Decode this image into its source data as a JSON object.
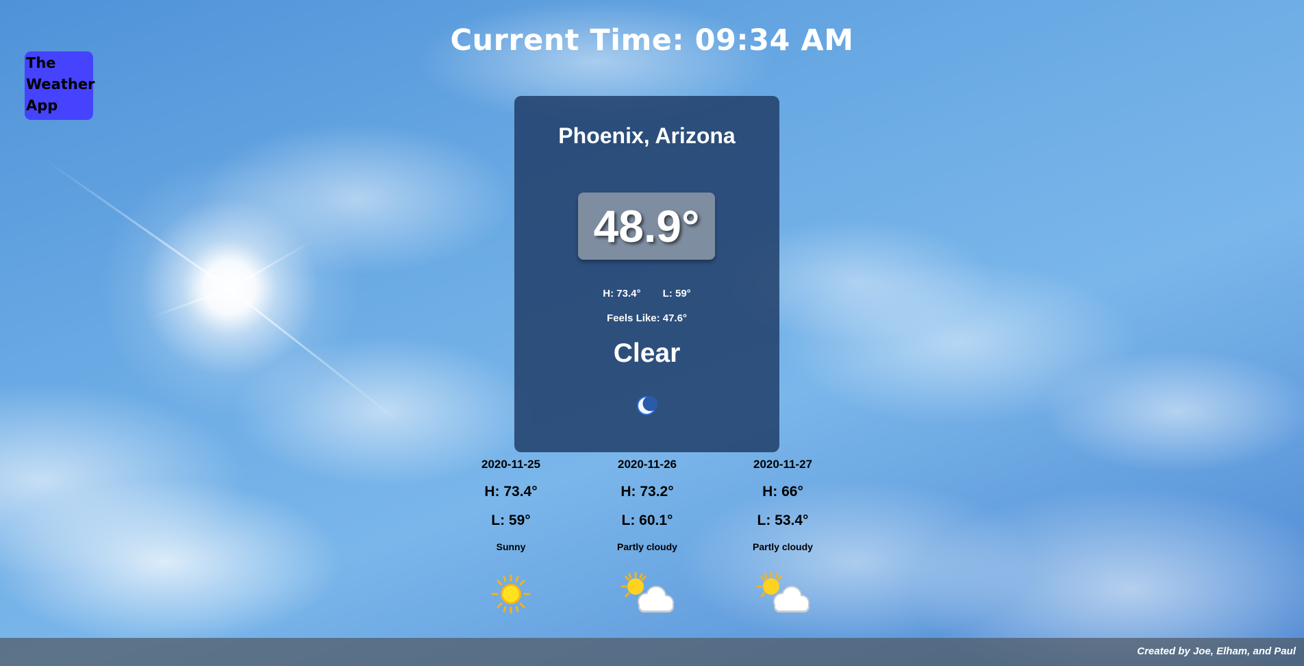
{
  "app": {
    "logo_text": "The\nWeather\nApp"
  },
  "clock": {
    "label": "Current Time: 09:34 AM"
  },
  "current": {
    "city": "Phoenix, Arizona",
    "temperature": "48.9°",
    "high": "H: 73.4°",
    "low": "L: 59°",
    "feels_like": "Feels Like: 47.6°",
    "condition": "Clear",
    "icon": "moon-icon"
  },
  "forecast": [
    {
      "date": "2020-11-25",
      "high": "H: 73.4°",
      "low": "L: 59°",
      "description": "Sunny",
      "icon": "sun-icon"
    },
    {
      "date": "2020-11-26",
      "high": "H: 73.2°",
      "low": "L: 60.1°",
      "description": "Partly cloudy",
      "icon": "partly-cloudy-icon"
    },
    {
      "date": "2020-11-27",
      "high": "H: 66°",
      "low": "L: 53.4°",
      "description": "Partly cloudy",
      "icon": "partly-cloudy-icon"
    }
  ],
  "footer": {
    "credit": "Created by Joe, Elham, and Paul"
  },
  "colors": {
    "logo_bg": "#4643ff",
    "card_bg": "#1d3964",
    "sun_yellow": "#ffd21f"
  }
}
